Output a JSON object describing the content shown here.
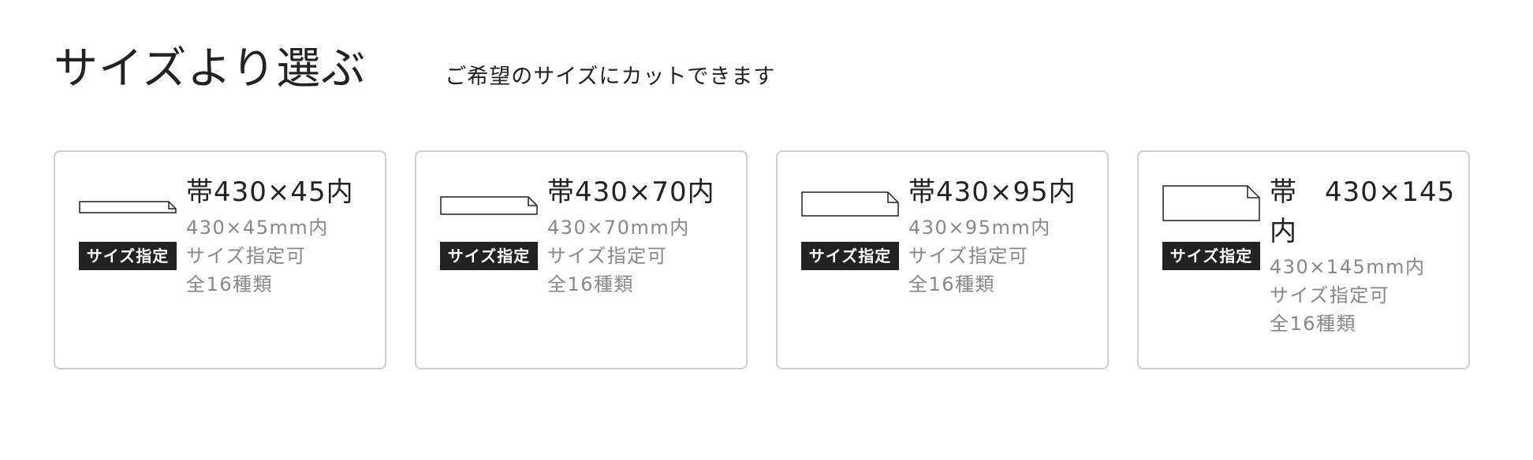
{
  "header": {
    "title": "サイズより選ぶ",
    "subtitle": "ご希望のサイズにカットできます"
  },
  "cards": [
    {
      "name": "帯430×45内",
      "badge": "サイズ指定",
      "size": "430×45mm内",
      "cut": "サイズ指定可",
      "count": "全16種類"
    },
    {
      "name": "帯430×70内",
      "badge": "サイズ指定",
      "size": "430×70mm内",
      "cut": "サイズ指定可",
      "count": "全16種類"
    },
    {
      "name": "帯430×95内",
      "badge": "サイズ指定",
      "size": "430×95mm内",
      "cut": "サイズ指定可",
      "count": "全16種類"
    },
    {
      "name": "帯　430×145内",
      "badge": "サイズ指定",
      "size": "430×145mm内",
      "cut": "サイズ指定可",
      "count": "全16種類"
    }
  ],
  "icons": {
    "shape": "strip-shape-icon"
  },
  "colors": {
    "badge_bg": "#222222",
    "detail_text": "#888888",
    "card_border": "#cfcfcf"
  }
}
